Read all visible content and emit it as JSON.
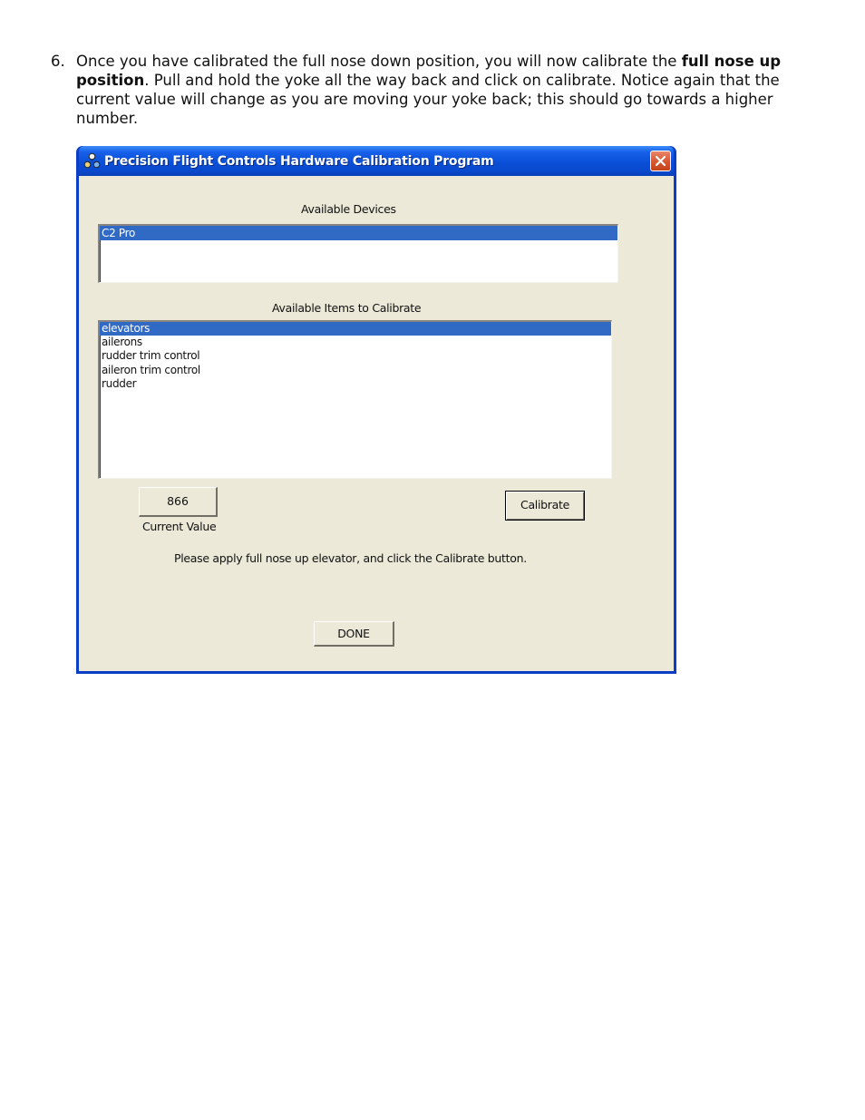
{
  "instruction": {
    "number": "6.",
    "text_before": "Once you have calibrated the full nose down position, you will now calibrate the ",
    "bold_text": "full nose up position",
    "text_after": ". Pull and hold the yoke all the way back and click on calibrate. Notice again that the current value will change as you are moving your yoke back; this should go towards a higher number."
  },
  "window": {
    "title": "Precision Flight Controls Hardware Calibration Program",
    "icon": "app-icon",
    "close_icon": "close-icon",
    "titlebar_color": "#0a4fd8",
    "client_color": "#ece9d8",
    "selection_color": "#316ac5"
  },
  "devices": {
    "label": "Available Devices",
    "items": [
      "C2 Pro"
    ],
    "selected": "C2 Pro"
  },
  "calibrate_items": {
    "label": "Available Items to Calibrate",
    "items": [
      "elevators",
      "ailerons",
      "rudder trim control",
      "aileron trim control",
      "rudder"
    ],
    "selected": "elevators"
  },
  "current_value": {
    "value": "866",
    "label": "Current Value"
  },
  "calibrate_button": "Calibrate",
  "status_message": "Please apply full nose up elevator, and click the Calibrate button.",
  "done_button": "DONE"
}
